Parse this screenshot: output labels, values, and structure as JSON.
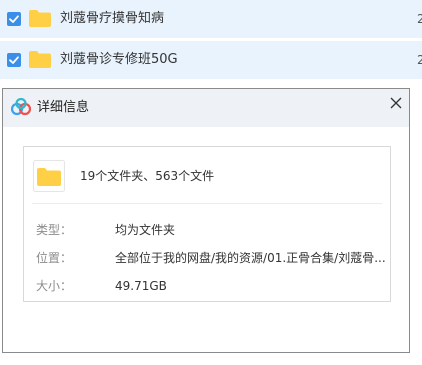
{
  "file_list": {
    "items": [
      {
        "name": "刘蔻骨疗摸骨知病",
        "checked": true,
        "extra": "2"
      },
      {
        "name": "刘蔻骨诊专修班50G",
        "checked": true,
        "extra": "2"
      }
    ]
  },
  "dialog": {
    "title": "详细信息",
    "close_icon": "close-icon",
    "summary": "19个文件夹、563个文件",
    "type_label": "类型：",
    "type_value": "均为文件夹",
    "location_label": "位置：",
    "location_value": "全部位于我的网盘/我的资源/01.正骨合集/刘蔻骨...",
    "size_label": "大小：",
    "size_value": "49.71GB"
  },
  "colors": {
    "row_background": "#e9f3fd",
    "checkbox": "#3b8fe8",
    "folder": "#ffd046",
    "title_bar": "#eef1f6"
  }
}
